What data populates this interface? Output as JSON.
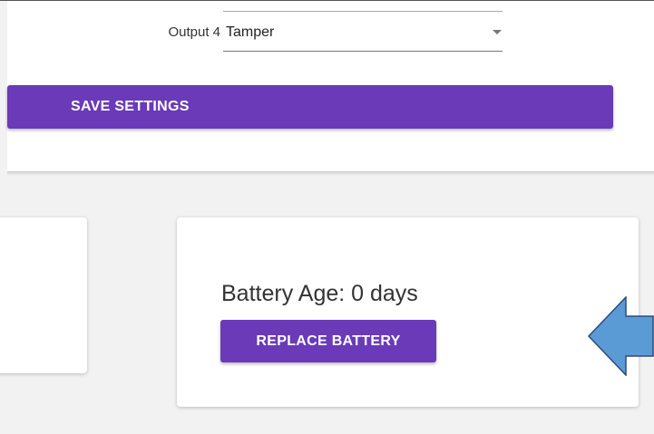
{
  "settings": {
    "output_label": "Output 4",
    "output_value": "Tamper",
    "save_label": "SAVE SETTINGS"
  },
  "battery": {
    "age_text": "Battery Age: 0 days",
    "replace_label": "REPLACE BATTERY"
  },
  "colors": {
    "accent": "#6a3ab9",
    "arrow_fill": "#5b9bd5",
    "arrow_stroke": "#2e4a7a"
  },
  "icons": {
    "dropdown": "chevron-down-icon",
    "annotation": "left-arrow-icon"
  }
}
